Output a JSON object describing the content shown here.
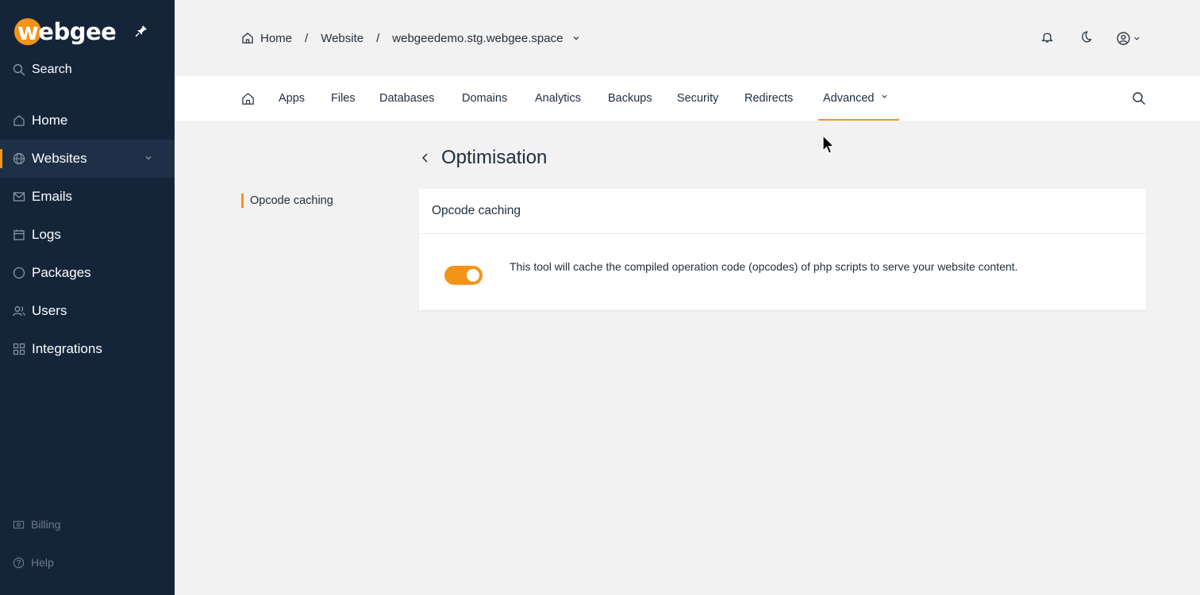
{
  "sidebar": {
    "logo_text": "webgee",
    "search_label": "Search",
    "items": [
      {
        "label": "Home",
        "icon": "home-icon"
      },
      {
        "label": "Websites",
        "icon": "globe-icon",
        "active": true
      },
      {
        "label": "Emails",
        "icon": "mail-icon"
      },
      {
        "label": "Logs",
        "icon": "calendar-icon"
      },
      {
        "label": "Packages",
        "icon": "circle-icon"
      },
      {
        "label": "Users",
        "icon": "users-icon"
      },
      {
        "label": "Integrations",
        "icon": "grid-icon"
      }
    ],
    "bottom": [
      {
        "label": "Billing",
        "icon": "billing-icon"
      },
      {
        "label": "Help",
        "icon": "help-icon"
      }
    ]
  },
  "breadcrumb": {
    "home": "Home",
    "sep": "/",
    "website": "Website",
    "domain": "webgeedemo.stg.webgee.space"
  },
  "tabs": [
    {
      "label": "Apps"
    },
    {
      "label": "Files"
    },
    {
      "label": "Databases"
    },
    {
      "label": "Domains"
    },
    {
      "label": "Analytics"
    },
    {
      "label": "Backups"
    },
    {
      "label": "Security"
    },
    {
      "label": "Redirects"
    },
    {
      "label": "Advanced",
      "active": true
    }
  ],
  "page": {
    "title": "Optimisation",
    "subnav_item": "Opcode caching",
    "card_title": "Opcode caching",
    "card_description": "This tool will cache the compiled operation code (opcodes) of php scripts to serve your website content.",
    "toggle_on": true
  },
  "colors": {
    "accent": "#f39419",
    "sidebar_bg": "#14253a",
    "page_bg": "#f2f2f2"
  }
}
